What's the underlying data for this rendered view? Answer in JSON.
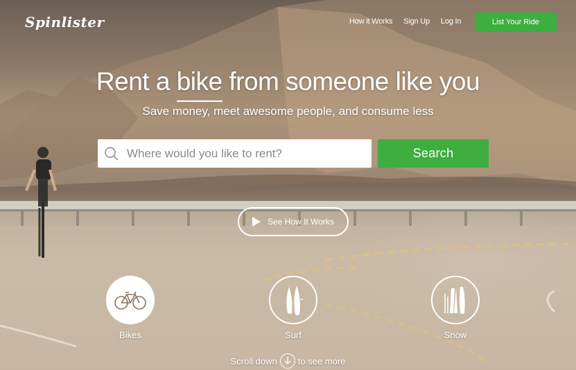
{
  "brand": {
    "logo_text": "Spinlister"
  },
  "nav": {
    "items": [
      {
        "label": "How it Works"
      },
      {
        "label": "Sign Up"
      },
      {
        "label": "Log In"
      }
    ],
    "cta_label": "List Your Ride"
  },
  "hero": {
    "headline_before": "Rent a ",
    "headline_highlight": "bike",
    "headline_after": " from someone like you",
    "subheadline": "Save money, meet awesome people, and consume less"
  },
  "search": {
    "placeholder": "Where would you like to rent?",
    "value": "",
    "button_label": "Search"
  },
  "video": {
    "label": "See How It Works"
  },
  "categories": [
    {
      "label": "Bikes",
      "icon": "bike-icon",
      "active": true
    },
    {
      "label": "Surf",
      "icon": "surfboard-icon",
      "active": false
    },
    {
      "label": "Snow",
      "icon": "ski-icon",
      "active": false
    }
  ],
  "scroll": {
    "before": "Scroll down",
    "after": "to see more"
  },
  "colors": {
    "accent": "#3dae3f",
    "text_on_hero": "#ffffff"
  }
}
